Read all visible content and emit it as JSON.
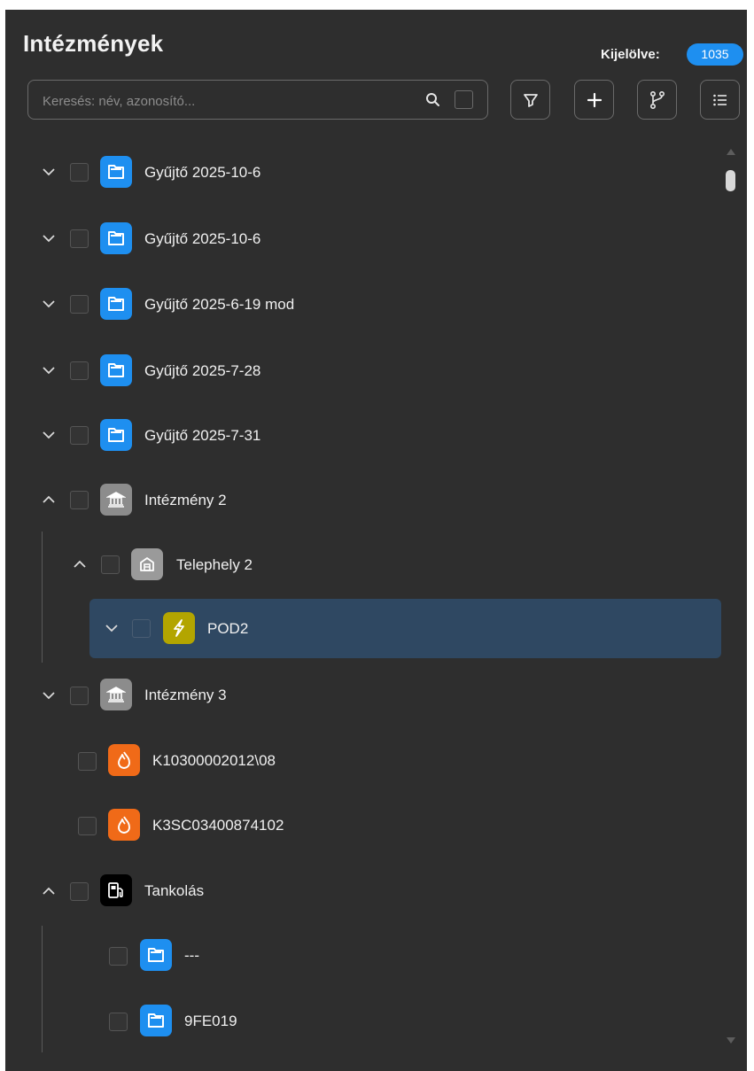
{
  "panel": {
    "title": "Intézmények",
    "selected_label": "Kijelölve:",
    "selected_count": "1035"
  },
  "search": {
    "placeholder": "Keresés: név, azonosító..."
  },
  "toolbar": {
    "buttons": [
      "filter-icon",
      "plus-icon",
      "branch-icon",
      "list-icon"
    ]
  },
  "tree": {
    "items": [
      {
        "label": "Gyűjtő 2025-10-6",
        "icon": "folder-icon",
        "expanded": false
      },
      {
        "label": "Gyűjtő 2025-10-6",
        "icon": "folder-icon",
        "expanded": false
      },
      {
        "label": "Gyűjtő 2025-6-19 mod",
        "icon": "folder-icon",
        "expanded": false
      },
      {
        "label": "Gyűjtő 2025-7-28",
        "icon": "folder-icon",
        "expanded": false
      },
      {
        "label": "Gyűjtő 2025-7-31",
        "icon": "folder-icon",
        "expanded": false
      },
      {
        "label": "Intézmény 2",
        "icon": "institution-icon",
        "expanded": true
      },
      {
        "label": "Telephely 2",
        "icon": "site-building-icon",
        "expanded": true
      },
      {
        "label": "POD2",
        "icon": "electricity-icon",
        "expanded": false,
        "selected": true
      },
      {
        "label": "Intézmény 3",
        "icon": "institution-icon",
        "expanded": false
      },
      {
        "label": "K10300002012\\08",
        "icon": "gas-flame-icon"
      },
      {
        "label": "K3SC03400874102",
        "icon": "gas-flame-icon"
      },
      {
        "label": "Tankolás",
        "icon": "fuel-pump-icon",
        "expanded": true
      },
      {
        "label": "---",
        "icon": "folder-icon"
      },
      {
        "label": "9FE019",
        "icon": "folder-icon"
      }
    ]
  },
  "colors": {
    "background": "#2e2e2e",
    "accent": "#1e8ff0",
    "selected_row": "#2f4862",
    "electricity": "#b3a500",
    "gas": "#f06a18"
  }
}
